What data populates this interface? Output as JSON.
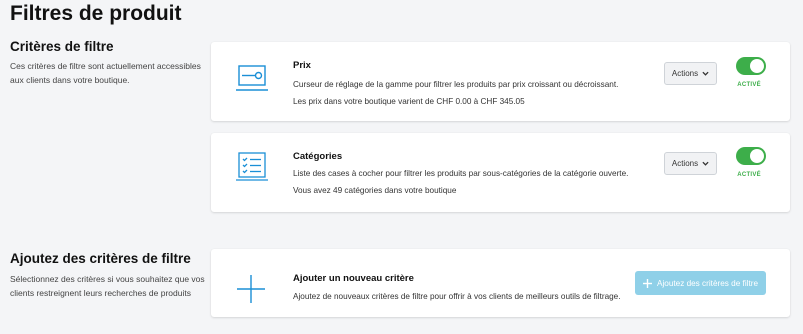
{
  "page": {
    "title": "Filtres de produit"
  },
  "filters_section": {
    "title": "Critères de filtre",
    "description": "Ces critères de filtre sont actuellement accessibles aux clients dans votre boutique."
  },
  "filters": [
    {
      "icon": "range-slider-icon",
      "title": "Prix",
      "description": "Curseur de réglage de la gamme pour filtrer les produits par prix croissant ou décroissant.",
      "info": "Les prix dans votre boutique varient de CHF 0.00 à CHF 345.05",
      "actions_label": "Actions",
      "enabled": true,
      "status_label": "ACTIVÉ"
    },
    {
      "icon": "checklist-icon",
      "title": "Catégories",
      "description": "Liste des cases à cocher pour filtrer les produits par sous-catégories de la catégorie ouverte.",
      "info": "Vous avez 49 catégories dans votre boutique",
      "actions_label": "Actions",
      "enabled": true,
      "status_label": "ACTIVÉ"
    }
  ],
  "add_section": {
    "title": "Ajoutez des critères de filtre",
    "description": "Sélectionnez des critères si vous souhaitez que vos clients restreignent leurs recherches de produits",
    "card_title": "Ajouter un nouveau critère",
    "card_description": "Ajoutez de nouveaux critères de filtre pour offrir à vos clients de meilleurs outils de filtrage.",
    "button_label": "Ajoutez des critères de filtre",
    "button_icon": "plus-icon"
  },
  "colors": {
    "accent_blue": "#1a8fd6",
    "toggle_green": "#3dae4a",
    "add_button": "#8fd0e8",
    "background": "#f4f5f7"
  }
}
